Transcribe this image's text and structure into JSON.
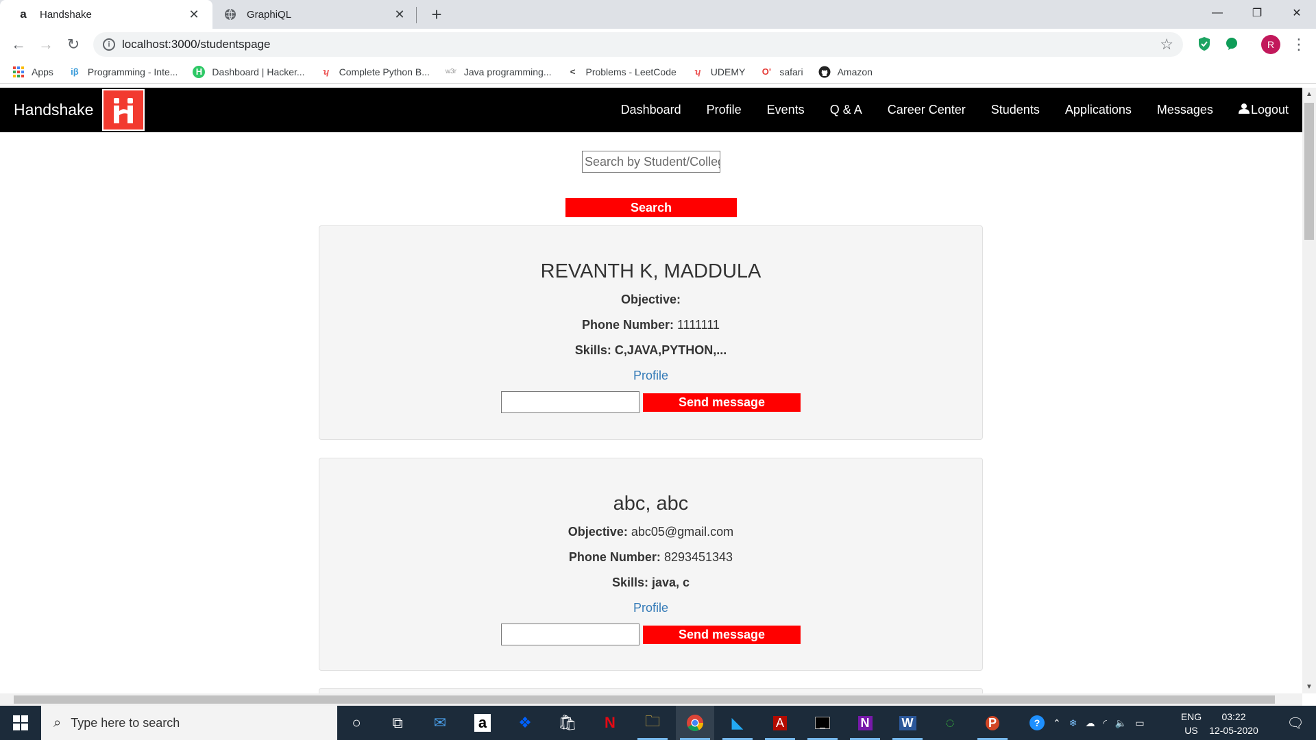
{
  "browser": {
    "tabs": [
      {
        "title": "Handshake",
        "favicon": "a",
        "active": true
      },
      {
        "title": "GraphiQL",
        "favicon": "globe-icon",
        "active": false
      }
    ],
    "url": "localhost:3000/studentspage",
    "profile_initial": "R",
    "bookmarks": [
      {
        "label": "Apps",
        "icon": "apps-grid-icon"
      },
      {
        "label": "Programming - Inte...",
        "icon": "ib-icon"
      },
      {
        "label": "Dashboard | Hacker...",
        "icon": "hackerrank-icon"
      },
      {
        "label": "Complete Python B...",
        "icon": "udemy-icon"
      },
      {
        "label": "Java programming...",
        "icon": "w3r-icon"
      },
      {
        "label": "Problems - LeetCode",
        "icon": "leetcode-icon"
      },
      {
        "label": "UDEMY",
        "icon": "udemy-icon"
      },
      {
        "label": "safari",
        "icon": "safari-icon"
      },
      {
        "label": "Amazon",
        "icon": "github-icon"
      }
    ]
  },
  "app": {
    "brand": "Handshake",
    "nav": [
      "Dashboard",
      "Profile",
      "Events",
      "Q & A",
      "Career Center",
      "Students",
      "Applications",
      "Messages"
    ],
    "logout": "Logout",
    "search_placeholder": "Search by Student/College",
    "search_button": "Search",
    "labels": {
      "objective": "Objective:",
      "phone": "Phone Number:",
      "skills": "Skills:",
      "profile_link": "Profile",
      "send_message": "Send message"
    },
    "students": [
      {
        "name": "REVANTH K, MADDULA",
        "objective": "",
        "phone": "1111111",
        "skills": "C,JAVA,PYTHON,..."
      },
      {
        "name": "abc, abc",
        "objective": "abc05@gmail.com",
        "phone": "8293451343",
        "skills": "java, c"
      }
    ]
  },
  "taskbar": {
    "search_text": "Type here to search",
    "lang": [
      "ENG",
      "US"
    ],
    "time": "03:22",
    "date": "12-05-2020"
  },
  "colors": {
    "navbar": "#000000",
    "accent_red": "#ff0000",
    "link_blue": "#337ab7",
    "card_bg": "#f5f5f5"
  }
}
